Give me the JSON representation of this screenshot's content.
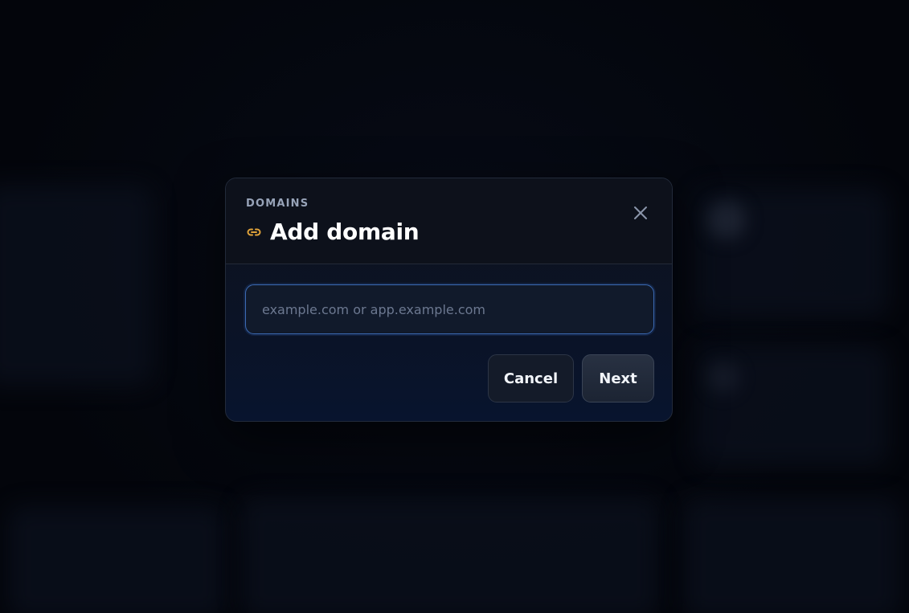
{
  "dialog": {
    "eyebrow": "DOMAINS",
    "title": "Add domain",
    "title_icon": "link-icon",
    "close_icon": "close-icon",
    "input": {
      "value": "",
      "placeholder": "example.com or app.example.com"
    },
    "cancel_label": "Cancel",
    "next_label": "Next"
  },
  "colors": {
    "accent_icon": "#e0a33a",
    "input_border": "#3c6bb4",
    "background": "#03050b"
  }
}
